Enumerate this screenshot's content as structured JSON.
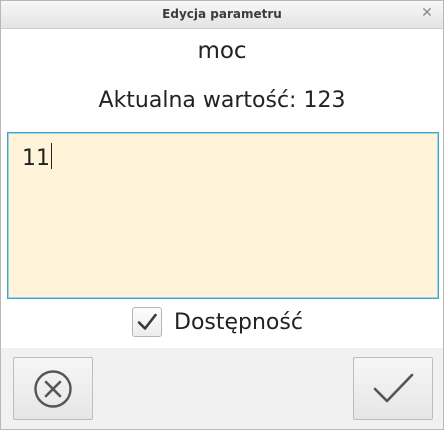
{
  "window": {
    "title": "Edycja parametru",
    "close_glyph": "✕"
  },
  "parameter": {
    "name": "moc",
    "current_label": "Aktualna wartość:",
    "current_value": "123"
  },
  "editor": {
    "value": "11",
    "background_color": "#fff4d9",
    "border_color": "#3fa7c9"
  },
  "availability": {
    "label": "Dostępność",
    "checked": true,
    "icon": "checkmark-icon"
  },
  "buttons": {
    "cancel_icon": "cancel-circle-x-icon",
    "confirm_icon": "checkmark-icon"
  }
}
